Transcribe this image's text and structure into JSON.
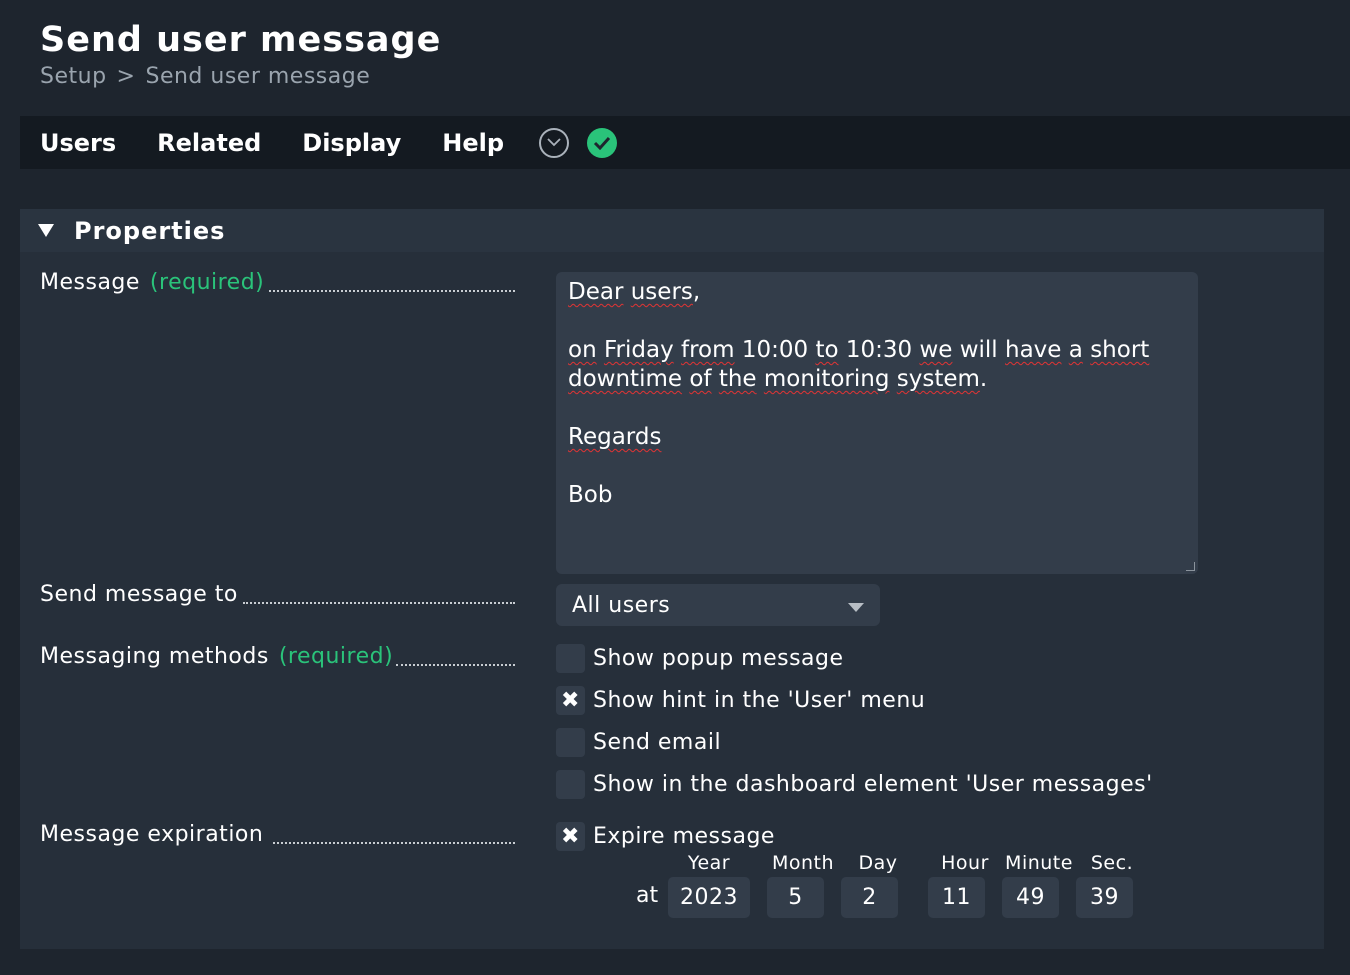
{
  "page": {
    "title": "Send user message",
    "breadcrumb": [
      "Setup",
      "Send user message"
    ],
    "breadcrumb_separator": ">"
  },
  "menu": {
    "items": [
      "Users",
      "Related",
      "Display",
      "Help"
    ],
    "icons": [
      "chevron-down-circle-icon",
      "check-circle-icon"
    ]
  },
  "colors": {
    "background": "#1e252e",
    "accent_green": "#2ac37a",
    "field_bg": "#333d4a",
    "spellcheck_red": "#e23434"
  },
  "properties": {
    "title": "Properties",
    "required_label": "(required)",
    "message": {
      "label": "Message",
      "lines": [
        "Dear users,",
        "",
        "on Friday from 10:00 to 10:30 we will have a short",
        "downtime of the monitoring system.",
        "",
        "Regards",
        "",
        "Bob"
      ]
    },
    "send_to": {
      "label": "Send message to",
      "selected": "All users"
    },
    "methods": {
      "label": "Messaging methods",
      "options": [
        {
          "label": "Show popup message",
          "checked": false
        },
        {
          "label": "Show hint in the 'User' menu",
          "checked": true
        },
        {
          "label": "Send email",
          "checked": false
        },
        {
          "label": "Show in the dashboard element 'User messages'",
          "checked": false
        }
      ]
    },
    "expiration": {
      "label": "Message expiration",
      "checkbox_label": "Expire message",
      "checked": true,
      "at_label": "at",
      "field_labels": [
        "Year",
        "Month",
        "Day",
        "Hour",
        "Minute",
        "Sec."
      ],
      "values": [
        "2023",
        "5",
        "2",
        "11",
        "49",
        "39"
      ]
    }
  },
  "check_mark": "✖"
}
